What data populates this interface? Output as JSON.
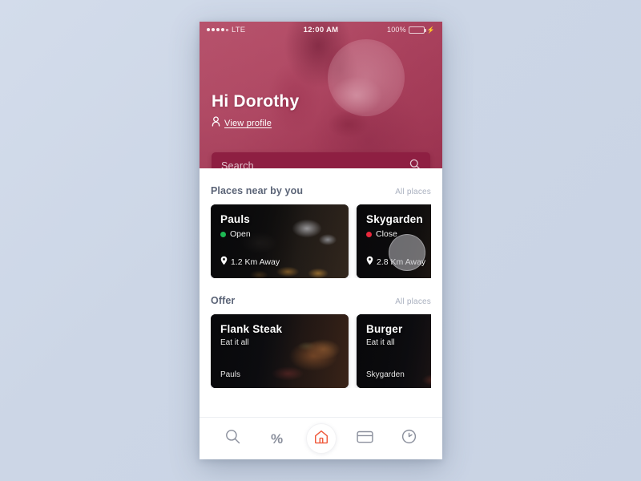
{
  "status_bar": {
    "signal_dots_filled": 4,
    "signal_dots_empty": 1,
    "network": "LTE",
    "time": "12:00 AM",
    "battery_percent": "100%",
    "battery_color": "#5ed63a"
  },
  "header": {
    "greeting": "Hi Dorothy",
    "profile_link": "View profile",
    "profile_icon": "person-icon",
    "overlay_color": "#b4566f"
  },
  "search": {
    "placeholder": "Search",
    "icon": "search-icon",
    "background": "#8e1f42"
  },
  "sections": [
    {
      "title": "Places near by you",
      "link": "All places",
      "cards": [
        {
          "name": "Pauls",
          "status": "Open",
          "status_color": "#1db954",
          "distance": "1.2 Km Away",
          "pin_icon": "map-pin-icon",
          "photo": "ph-pauls"
        },
        {
          "name": "Skygarden",
          "status": "Close",
          "status_color": "#e8283c",
          "distance": "2.8 Km Away",
          "pin_icon": "map-pin-icon",
          "photo": "ph-sky"
        }
      ]
    },
    {
      "title": "Offer",
      "link": "All places",
      "cards": [
        {
          "name": "Flank Steak",
          "subtitle": "Eat it all",
          "place": "Pauls",
          "photo": "ph-steak"
        },
        {
          "name": "Burger",
          "subtitle": "Eat it all",
          "place": "Skygarden",
          "photo": "ph-burger"
        }
      ]
    }
  ],
  "bottom_nav": {
    "active_color": "#ef5a3c",
    "inactive_color": "#8a8f9c",
    "items": [
      {
        "icon": "search-icon",
        "label": "Search",
        "active": false
      },
      {
        "icon": "percent-icon",
        "label": "Offers",
        "active": false
      },
      {
        "icon": "home-icon",
        "label": "Home",
        "active": true
      },
      {
        "icon": "credit-card-icon",
        "label": "Payments",
        "active": false
      },
      {
        "icon": "clock-icon",
        "label": "History",
        "active": false
      }
    ]
  }
}
